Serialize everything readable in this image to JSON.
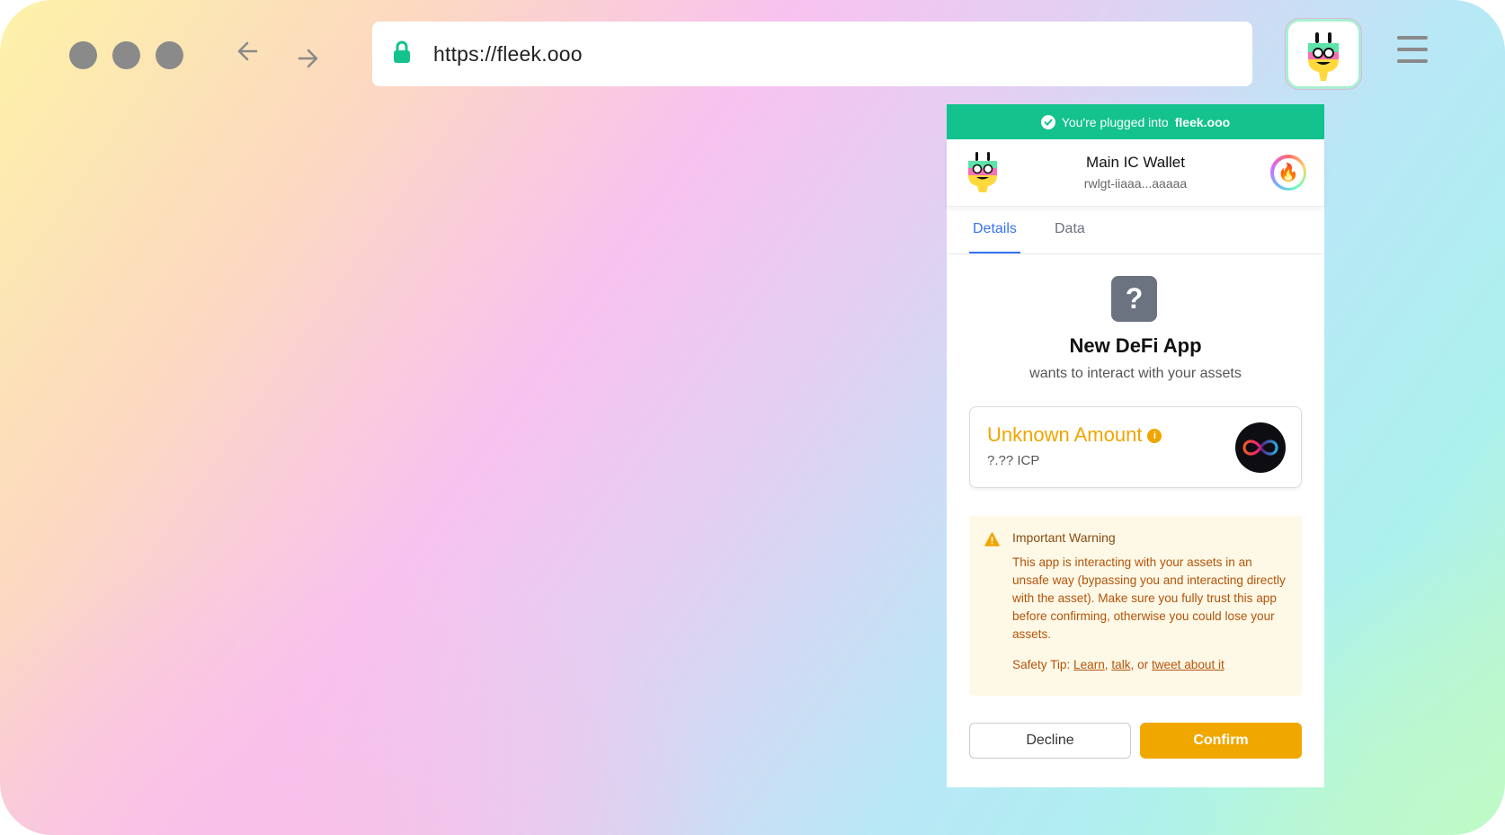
{
  "browser": {
    "url": "https://fleek.ooo",
    "window_controls": [
      "close",
      "minimize",
      "maximize"
    ],
    "icons": {
      "back": "arrow-left-icon",
      "forward": "arrow-right-icon",
      "lock": "lock-icon",
      "extension": "plug-icon",
      "menu": "hamburger-menu-icon"
    }
  },
  "popup": {
    "banner": {
      "prefix": "You're plugged into",
      "site": "fleek.ooo"
    },
    "wallet": {
      "name": "Main IC Wallet",
      "address": "rwlgt-iiaaa...aaaaa",
      "avatar_emoji": "🔥"
    },
    "tabs": [
      {
        "label": "Details",
        "active": true
      },
      {
        "label": "Data",
        "active": false
      }
    ],
    "app": {
      "icon_glyph": "?",
      "name": "New DeFi App",
      "subtitle": "wants to interact with your assets"
    },
    "amount": {
      "title": "Unknown Amount",
      "info_glyph": "i",
      "value": "?.?? ICP"
    },
    "warning": {
      "title": "Important Warning",
      "body": "This app is interacting with your assets in an unsafe way (bypassing you and interacting directly with the asset). Make sure you fully trust this app before confirming, otherwise you could lose your assets.",
      "tip_prefix": "Safety Tip:",
      "link_learn": "Learn",
      "sep1": ",",
      "link_talk": "talk",
      "sep2": ", or",
      "link_tweet": "tweet about it"
    },
    "buttons": {
      "decline": "Decline",
      "confirm": "Confirm"
    }
  },
  "colors": {
    "banner": "#13c28c",
    "accent": "#3574f0",
    "amount": "#f0a500",
    "confirm": "#f0a800",
    "warning_text": "#b45309",
    "warning_bg": "#fef9e7"
  }
}
